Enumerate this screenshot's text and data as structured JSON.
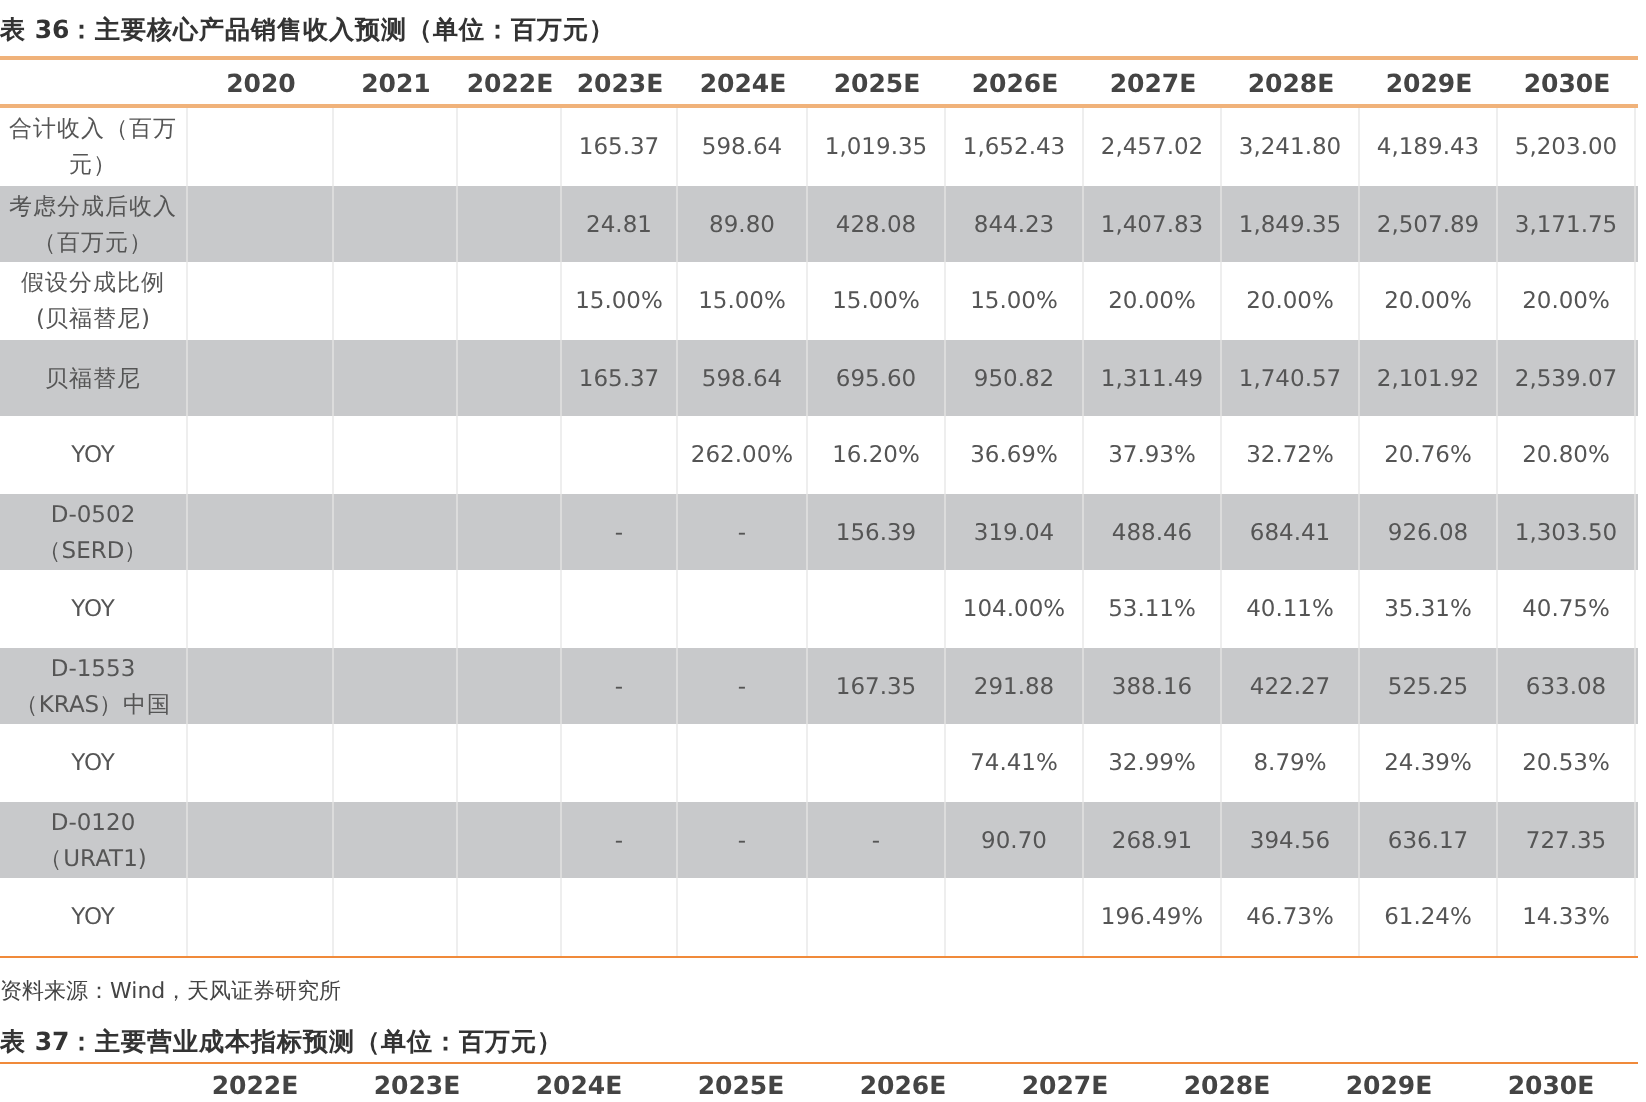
{
  "table_36": {
    "title": "表 36：主要核心产品销售收入预测（单位：百万元）",
    "columns": [
      "2020",
      "2021",
      "2022E",
      "2023E",
      "2024E",
      "2025E",
      "2026E",
      "2027E",
      "2028E",
      "2029E",
      "2030E"
    ],
    "rows": [
      {
        "label": "合计收入（百万元）",
        "shaded": false,
        "cells": [
          null,
          null,
          null,
          "165.37",
          "598.64",
          "1,019.35",
          "1,652.43",
          "2,457.02",
          "3,241.80",
          "4,189.43",
          "5,203.00"
        ]
      },
      {
        "label": "考虑分成后收入（百万元）",
        "shaded": true,
        "cells": [
          null,
          null,
          null,
          "24.81",
          "89.80",
          "428.08",
          "844.23",
          "1,407.83",
          "1,849.35",
          "2,507.89",
          "3,171.75"
        ]
      },
      {
        "label": "假设分成比例(贝福替尼)",
        "shaded": false,
        "cells": [
          null,
          null,
          null,
          "15.00%",
          "15.00%",
          "15.00%",
          "15.00%",
          "20.00%",
          "20.00%",
          "20.00%",
          "20.00%"
        ]
      },
      {
        "label": "贝福替尼",
        "shaded": true,
        "cells": [
          null,
          null,
          null,
          "165.37",
          "598.64",
          "695.60",
          "950.82",
          "1,311.49",
          "1,740.57",
          "2,101.92",
          "2,539.07"
        ]
      },
      {
        "label": "YOY",
        "shaded": false,
        "cells": [
          null,
          null,
          null,
          null,
          "262.00%",
          "16.20%",
          "36.69%",
          "37.93%",
          "32.72%",
          "20.76%",
          "20.80%"
        ]
      },
      {
        "label": "D-0502（SERD）",
        "shaded": true,
        "cells": [
          null,
          null,
          null,
          "-",
          "-",
          "156.39",
          "319.04",
          "488.46",
          "684.41",
          "926.08",
          "1,303.50"
        ]
      },
      {
        "label": "YOY",
        "shaded": false,
        "cells": [
          null,
          null,
          null,
          null,
          null,
          null,
          "104.00%",
          "53.11%",
          "40.11%",
          "35.31%",
          "40.75%"
        ]
      },
      {
        "label": "D-1553（KRAS）中国",
        "shaded": true,
        "cells": [
          null,
          null,
          null,
          "-",
          "-",
          "167.35",
          "291.88",
          "388.16",
          "422.27",
          "525.25",
          "633.08"
        ]
      },
      {
        "label": "YOY",
        "shaded": false,
        "cells": [
          null,
          null,
          null,
          null,
          null,
          null,
          "74.41%",
          "32.99%",
          "8.79%",
          "24.39%",
          "20.53%"
        ]
      },
      {
        "label": "D-0120（URAT1)",
        "shaded": true,
        "cells": [
          null,
          null,
          null,
          "-",
          "-",
          "-",
          "90.70",
          "268.91",
          "394.56",
          "636.17",
          "727.35"
        ]
      },
      {
        "label": "YOY",
        "shaded": false,
        "cells": [
          null,
          null,
          null,
          null,
          null,
          null,
          null,
          "196.49%",
          "46.73%",
          "61.24%",
          "14.33%"
        ]
      }
    ],
    "source": "资料来源：Wind，天风证券研究所"
  },
  "table_37": {
    "title": "表 37：主要营业成本指标预测（单位：百万元）",
    "columns": [
      "2022E",
      "2023E",
      "2024E",
      "2025E",
      "2026E",
      "2027E",
      "2028E",
      "2029E",
      "2030E"
    ]
  }
}
